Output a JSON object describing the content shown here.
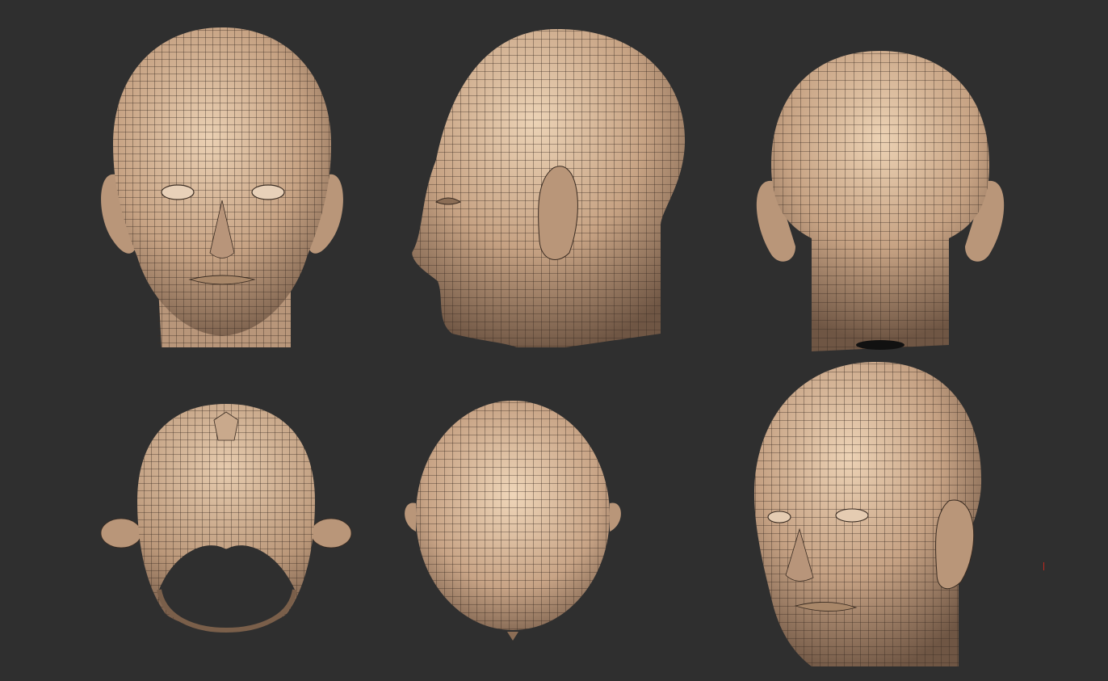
{
  "viewport": {
    "background": "#2f2f2f",
    "skin_color": "#c9a98c",
    "skin_highlight": "#e6c8aa",
    "wire_color": "#3a2c22"
  },
  "views": [
    {
      "id": "front",
      "label": ""
    },
    {
      "id": "side",
      "label": ""
    },
    {
      "id": "back",
      "label": ""
    },
    {
      "id": "bottom",
      "label": ""
    },
    {
      "id": "top",
      "label": ""
    },
    {
      "id": "three-quarter",
      "label": ""
    }
  ]
}
